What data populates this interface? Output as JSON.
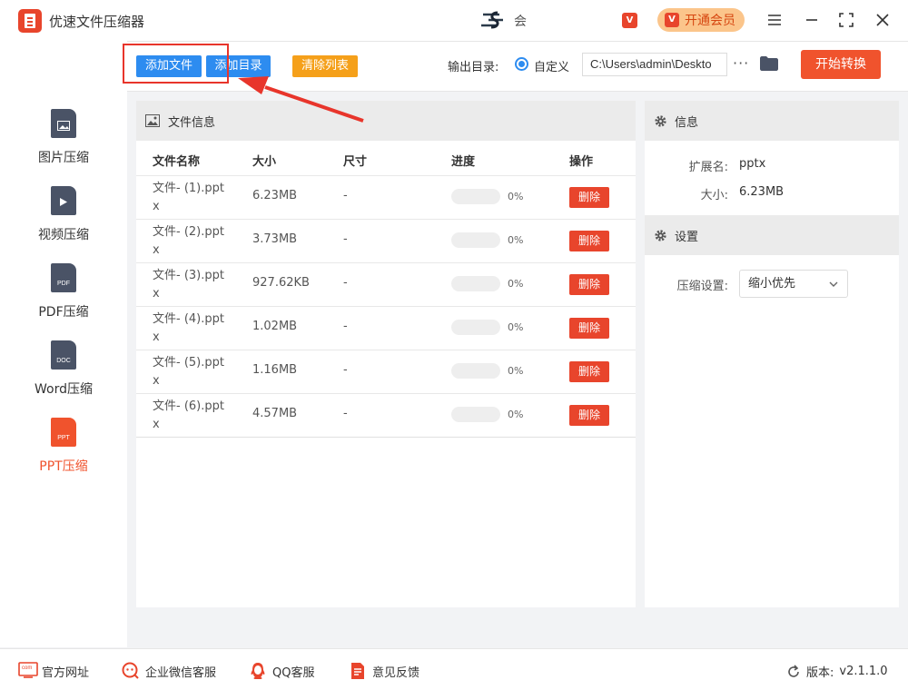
{
  "app": {
    "title": "优速文件压缩器",
    "brand_text": "会"
  },
  "window": {
    "vip_label": "开通会员",
    "vip_icon_glyph": "V"
  },
  "sidebar": {
    "items": [
      {
        "label": "图片压缩",
        "icon": "image-file-icon",
        "tag": "",
        "active": false
      },
      {
        "label": "视频压缩",
        "icon": "video-file-icon",
        "tag": "",
        "active": false
      },
      {
        "label": "PDF压缩",
        "icon": "pdf-file-icon",
        "tag": "PDF",
        "active": false
      },
      {
        "label": "Word压缩",
        "icon": "word-file-icon",
        "tag": "DOC",
        "active": false
      },
      {
        "label": "PPT压缩",
        "icon": "ppt-file-icon",
        "tag": "PPT",
        "active": true
      }
    ]
  },
  "toolbar": {
    "add_file": "添加文件",
    "add_dir": "添加目录",
    "clear_list": "清除列表",
    "output_label": "输出目录:",
    "custom_label": "自定义",
    "output_path": "C:\\Users\\admin\\Deskto",
    "more_label": "···",
    "start_label": "开始转换"
  },
  "file_panel": {
    "title": "文件信息",
    "columns": {
      "name": "文件名称",
      "size": "大小",
      "dim": "尺寸",
      "progress": "进度",
      "action": "操作"
    },
    "rows": [
      {
        "name": "文件- (1).pptx",
        "size": "6.23MB",
        "dim": "-",
        "progress": 0,
        "progress_text": "0%",
        "action": "删除"
      },
      {
        "name": "文件- (2).pptx",
        "size": "3.73MB",
        "dim": "-",
        "progress": 0,
        "progress_text": "0%",
        "action": "删除"
      },
      {
        "name": "文件- (3).pptx",
        "size": "927.62KB",
        "dim": "-",
        "progress": 0,
        "progress_text": "0%",
        "action": "删除"
      },
      {
        "name": "文件- (4).pptx",
        "size": "1.02MB",
        "dim": "-",
        "progress": 0,
        "progress_text": "0%",
        "action": "删除"
      },
      {
        "name": "文件- (5).pptx",
        "size": "1.16MB",
        "dim": "-",
        "progress": 0,
        "progress_text": "0%",
        "action": "删除"
      },
      {
        "name": "文件- (6).pptx",
        "size": "4.57MB",
        "dim": "-",
        "progress": 0,
        "progress_text": "0%",
        "action": "删除"
      }
    ]
  },
  "info_panel": {
    "title": "信息",
    "ext_label": "扩展名:",
    "ext_value": "pptx",
    "size_label": "大小:",
    "size_value": "6.23MB"
  },
  "settings_panel": {
    "title": "设置",
    "compress_label": "压缩设置:",
    "compress_value": "缩小优先"
  },
  "footer": {
    "website": "官方网址",
    "website_icon_text": "com",
    "wechat": "企业微信客服",
    "qq": "QQ客服",
    "feedback": "意见反馈",
    "version_label": "版本:",
    "version_value": "v2.1.1.0"
  },
  "colors": {
    "accent": "#f0532d",
    "blue": "#2d8cf0",
    "orange": "#f5a01a",
    "annotation": "#e8352b"
  }
}
